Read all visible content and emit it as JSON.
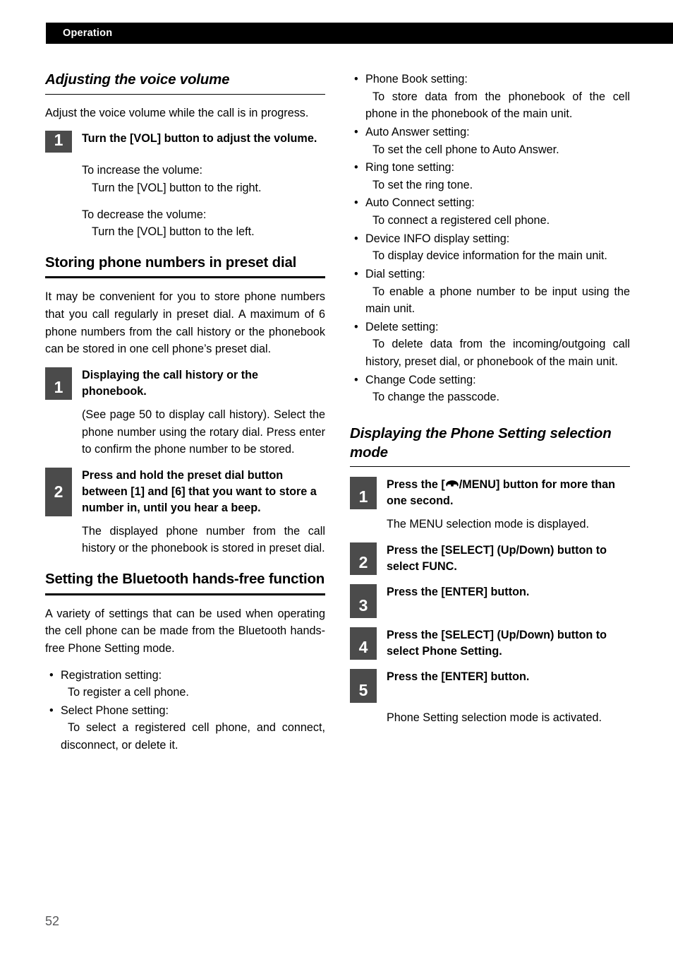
{
  "header": {
    "section": "Operation"
  },
  "folio": {
    "page_number": "52"
  },
  "icons": {
    "phone": "phone-handset-icon"
  },
  "left_column": {
    "heading_voice": "Adjusting the voice volume",
    "intro_voice": "Adjust the voice volume while the call is in progress.",
    "step_voice_1": {
      "number": "1",
      "title": "Turn the [VOL] button to adjust the volume.",
      "lines": [
        "To increase the volume:",
        "Turn the [VOL] button to the right.",
        "To decrease the volume:",
        "Turn the [VOL] button to the left."
      ]
    },
    "heading_preset": "Storing phone numbers in preset dial",
    "intro_preset": "It may be convenient for you to store phone numbers that you call regularly in preset dial. A maximum of 6 phone numbers from the call history or the phonebook can be stored in one cell phone’s preset dial.",
    "step_preset_1": {
      "number": "1",
      "title": "Displaying the call history or the phonebook.",
      "body": "(See page 50 to display call history). Select the phone number using the rotary dial. Press enter to confirm the phone number to be stored."
    },
    "step_preset_2": {
      "number": "2",
      "title": "Press and hold the preset dial button between [1] and [6] that you want to store a number in, until you hear a beep.",
      "body": "The displayed phone number from the call history or the phonebook is stored in preset dial."
    },
    "heading_bluetooth": "Setting the Bluetooth hands-free function",
    "intro_bluetooth": "A variety of settings that can be used when operating the cell phone can be made from the Bluetooth hands-free Phone Setting mode.",
    "bullets": [
      {
        "term": "Registration setting:",
        "desc": "To register a cell phone."
      },
      {
        "term": "Select Phone setting:",
        "desc": "To select a registered cell phone, and connect, disconnect, or delete it."
      }
    ]
  },
  "right_column": {
    "bullets": [
      {
        "term": "Phone Book setting:",
        "desc": "To store data from the phonebook of the cell phone in the phonebook of the main unit."
      },
      {
        "term": "Auto Answer setting:",
        "desc": "To set the cell phone to Auto Answer."
      },
      {
        "term": "Ring tone setting:",
        "desc": "To set the ring tone."
      },
      {
        "term": "Auto Connect setting:",
        "desc": "To connect a registered cell phone."
      },
      {
        "term": "Device INFO display setting:",
        "desc": "To display device information for the main unit."
      },
      {
        "term": "Dial setting:",
        "desc": "To enable a phone number to be input using the main unit."
      },
      {
        "term": "Delete setting:",
        "desc": "To delete data from the incoming/outgoing call history, preset dial, or phonebook of the main unit."
      },
      {
        "term": "Change Code setting:",
        "desc": "To change the passcode."
      }
    ],
    "heading_display_mode": "Displaying the Phone Setting selection mode",
    "step_1": {
      "number": "1",
      "title_before": "Press the [",
      "title_after": "/MENU] button for more than one second.",
      "body": "The MENU selection mode is displayed."
    },
    "step_2": {
      "number": "2",
      "title": "Press the [SELECT] (Up/Down) button to select FUNC."
    },
    "step_3": {
      "number": "3",
      "title": "Press the [ENTER] button."
    },
    "step_4": {
      "number": "4",
      "title": "Press the [SELECT] (Up/Down) button to select Phone Setting."
    },
    "step_5": {
      "number": "5",
      "title": "Press the [ENTER] button.",
      "body": "Phone Setting selection mode is activated."
    }
  }
}
